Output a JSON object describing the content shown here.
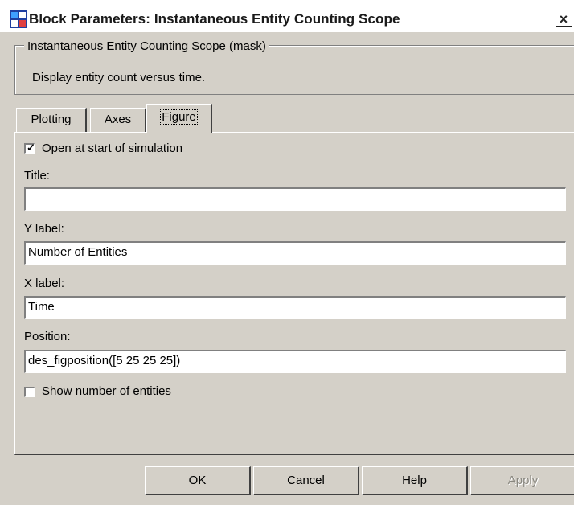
{
  "window": {
    "title": "Block Parameters: Instantaneous Entity Counting Scope"
  },
  "mask": {
    "group_title": "Instantaneous Entity Counting Scope (mask)",
    "description": "Display entity count versus time."
  },
  "tabs": [
    {
      "label": "Plotting",
      "active": false
    },
    {
      "label": "Axes",
      "active": false
    },
    {
      "label": "Figure",
      "active": true
    }
  ],
  "figure": {
    "open_at_start": {
      "label": "Open at start of simulation",
      "checked": true
    },
    "title": {
      "label": "Title:",
      "value": ""
    },
    "ylabel": {
      "label": "Y label:",
      "value": "Number of Entities"
    },
    "xlabel": {
      "label": "X label:",
      "value": "Time"
    },
    "position": {
      "label": "Position:",
      "value": "des_figposition([5 25 25 25])"
    },
    "show_count": {
      "label": "Show number of entities",
      "checked": false
    }
  },
  "buttons": {
    "ok": "OK",
    "cancel": "Cancel",
    "help": "Help",
    "apply": "Apply"
  }
}
